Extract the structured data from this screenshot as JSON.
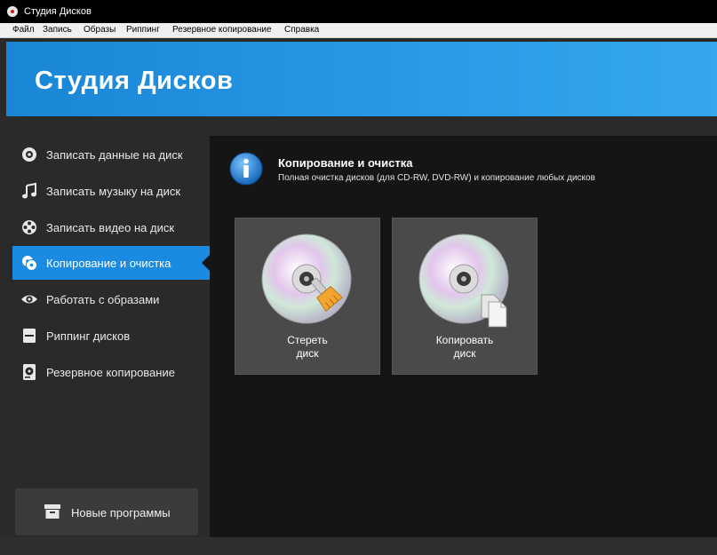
{
  "window": {
    "title": "Студия Дисков"
  },
  "menu": [
    "Файл",
    "Запись",
    "Образы",
    "Риппинг",
    "Резервное копирование",
    "Справка"
  ],
  "header": {
    "app_title": "Студия Дисков"
  },
  "sidebar": {
    "items": [
      {
        "label": "Записать данные на диск",
        "icon": "disc-icon",
        "active": false
      },
      {
        "label": "Записать музыку на диск",
        "icon": "music-note-icon",
        "active": false
      },
      {
        "label": "Записать видео на диск",
        "icon": "film-reel-icon",
        "active": false
      },
      {
        "label": "Копирование и очистка",
        "icon": "copy-discs-icon",
        "active": true
      },
      {
        "label": "Работать с образами",
        "icon": "eye-icon",
        "active": false
      },
      {
        "label": "Риппинг дисков",
        "icon": "drive-icon",
        "active": false
      },
      {
        "label": "Резервное копирование",
        "icon": "backup-icon",
        "active": false
      }
    ],
    "new_programs_label": "Новые программы"
  },
  "main": {
    "title": "Копирование и очистка",
    "description": "Полная очистка дисков (для CD-RW, DVD-RW) и копирование любых дисков",
    "tiles": [
      {
        "label": "Стереть\nдиск",
        "icon": "erase-disc-icon"
      },
      {
        "label": "Копировать\nдиск",
        "icon": "copy-disc-icon"
      }
    ]
  },
  "colors": {
    "accent": "#1a8be0",
    "header": "#2a9ae6",
    "content_bg": "#151515",
    "sidebar_bg": "#2a2a2a",
    "tile_bg": "#4a4a4a"
  }
}
